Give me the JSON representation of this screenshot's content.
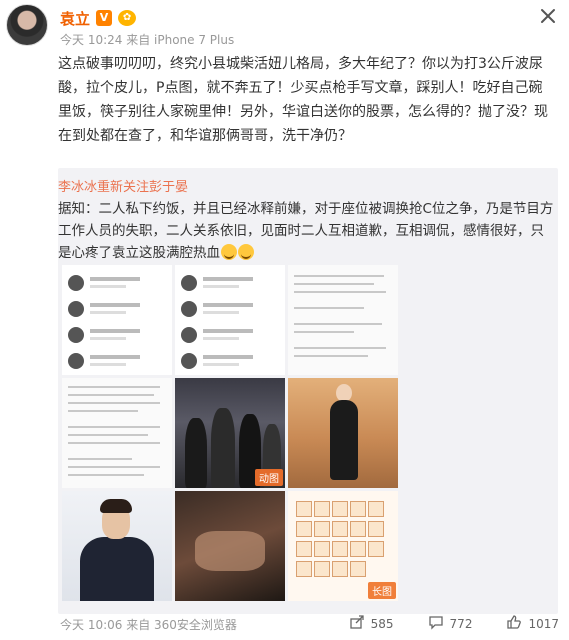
{
  "post": {
    "author": "袁立",
    "vip_badge": "V",
    "level_badge": "✿",
    "meta": "今天 10:24 来自 iPhone 7 Plus",
    "text": "这点破事叨叨叨，终究小县城柴活妞儿格局，多大年纪了？你以为打3公斤波尿酸，拉个皮儿，P点图，就不奔五了！少买点枪手写文章，踩别人！吃好自己碗里饭，筷子别往人家碗里伸！另外，华谊白送你的股票，怎么得的？抛了没？现在到处都在查了，和华谊那俩哥哥，洗干净仍？"
  },
  "repost": {
    "user": "李冰冰重新关注彭于晏",
    "text": "据知：二人私下约饭，并且已经冰释前嫌，对于座位被调换抢C位之争，乃是节目方工作人员的失职，二人关系依旧，见面时二人互相道歉，互相调侃，感情很好，只是心疼了袁立这股满腔热血",
    "gif_badge": "动图",
    "long_badge": "长图"
  },
  "footer": {
    "time": "今天 10:06 来自 360安全浏览器",
    "shares": "585",
    "comments": "772",
    "likes": "1017"
  },
  "icons": [
    "close-icon",
    "share-icon",
    "comment-icon",
    "like-icon"
  ],
  "colors": {
    "accent": "#f06000",
    "repost_bg": "#f2f2f5",
    "link": "#eb7350"
  }
}
